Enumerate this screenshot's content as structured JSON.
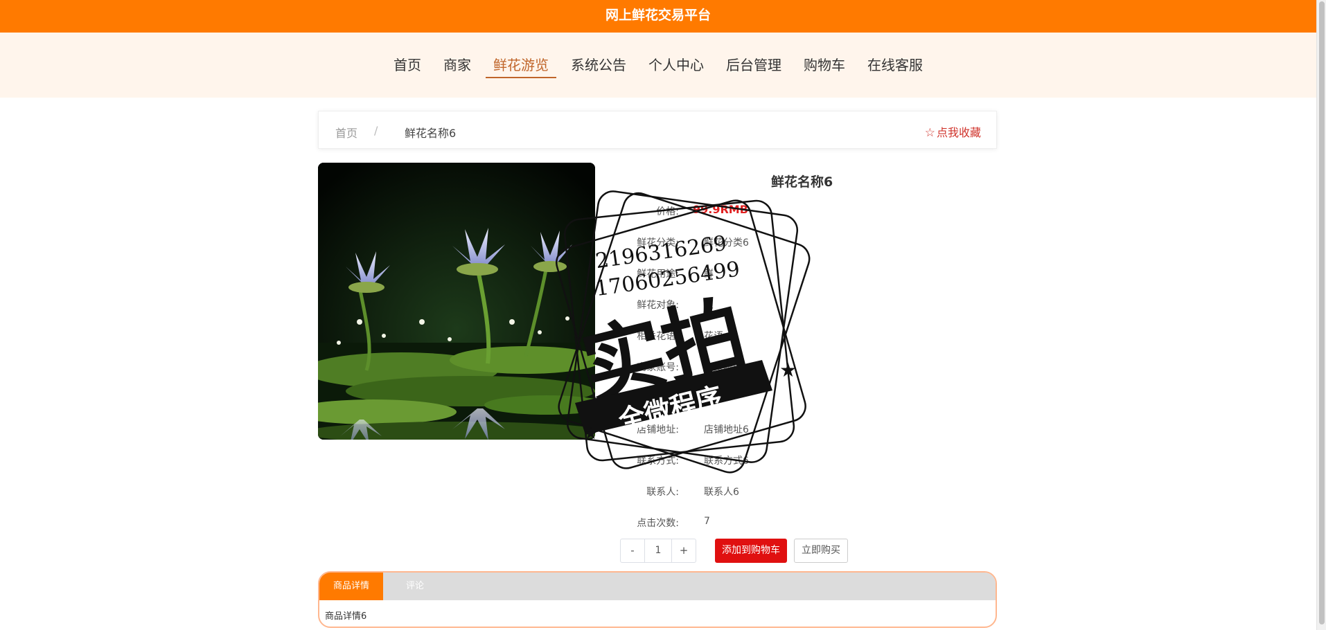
{
  "site": {
    "title": "网上鲜花交易平台"
  },
  "nav": {
    "items": [
      "首页",
      "商家",
      "鲜花游览",
      "系统公告",
      "个人中心",
      "后台管理",
      "购物车",
      "在线客服"
    ],
    "active_index": 2
  },
  "breadcrumb": {
    "home": "首页",
    "separator": "/",
    "current": "鲜花名称6"
  },
  "favorite": {
    "label": "点我收藏"
  },
  "product": {
    "name": "鲜花名称6",
    "price_label": "价格:",
    "price": "99.9RMB",
    "fields": [
      {
        "label": "鲜花分类:",
        "value": "鲜花分类6"
      },
      {
        "label": "鲜花用途:",
        "value": "鲜"
      },
      {
        "label": "鲜花对象:",
        "value": "人"
      },
      {
        "label": "相关花语:",
        "value": "花语"
      },
      {
        "label": "商家账号:",
        "value": "商家账号"
      },
      {
        "label": "店铺名称:",
        "value": ""
      },
      {
        "label": "店铺地址:",
        "value": "店铺地址6"
      },
      {
        "label": "联系方式:",
        "value": "联系方式6"
      },
      {
        "label": "联系人:",
        "value": "联系人6"
      },
      {
        "label": "点击次数:",
        "value": "7"
      }
    ]
  },
  "purchase": {
    "minus": "-",
    "quantity": "1",
    "plus": "+",
    "add_to_cart": "添加到购物车",
    "buy_now": "立即购买"
  },
  "tabs": {
    "items": [
      "商品详情",
      "评论"
    ],
    "active_index": 0,
    "content": "商品详情6"
  },
  "watermark": {
    "main": "实拍",
    "banner": "全微程序",
    "line1": "2196316269",
    "line2": "17060256499"
  },
  "colors": {
    "brand": "#ff7a00",
    "nav_bg": "#fff5ec",
    "nav_active": "#c0652a",
    "price": "#e02020",
    "cart_button": "#e01010",
    "favorite": "#d0342c"
  }
}
